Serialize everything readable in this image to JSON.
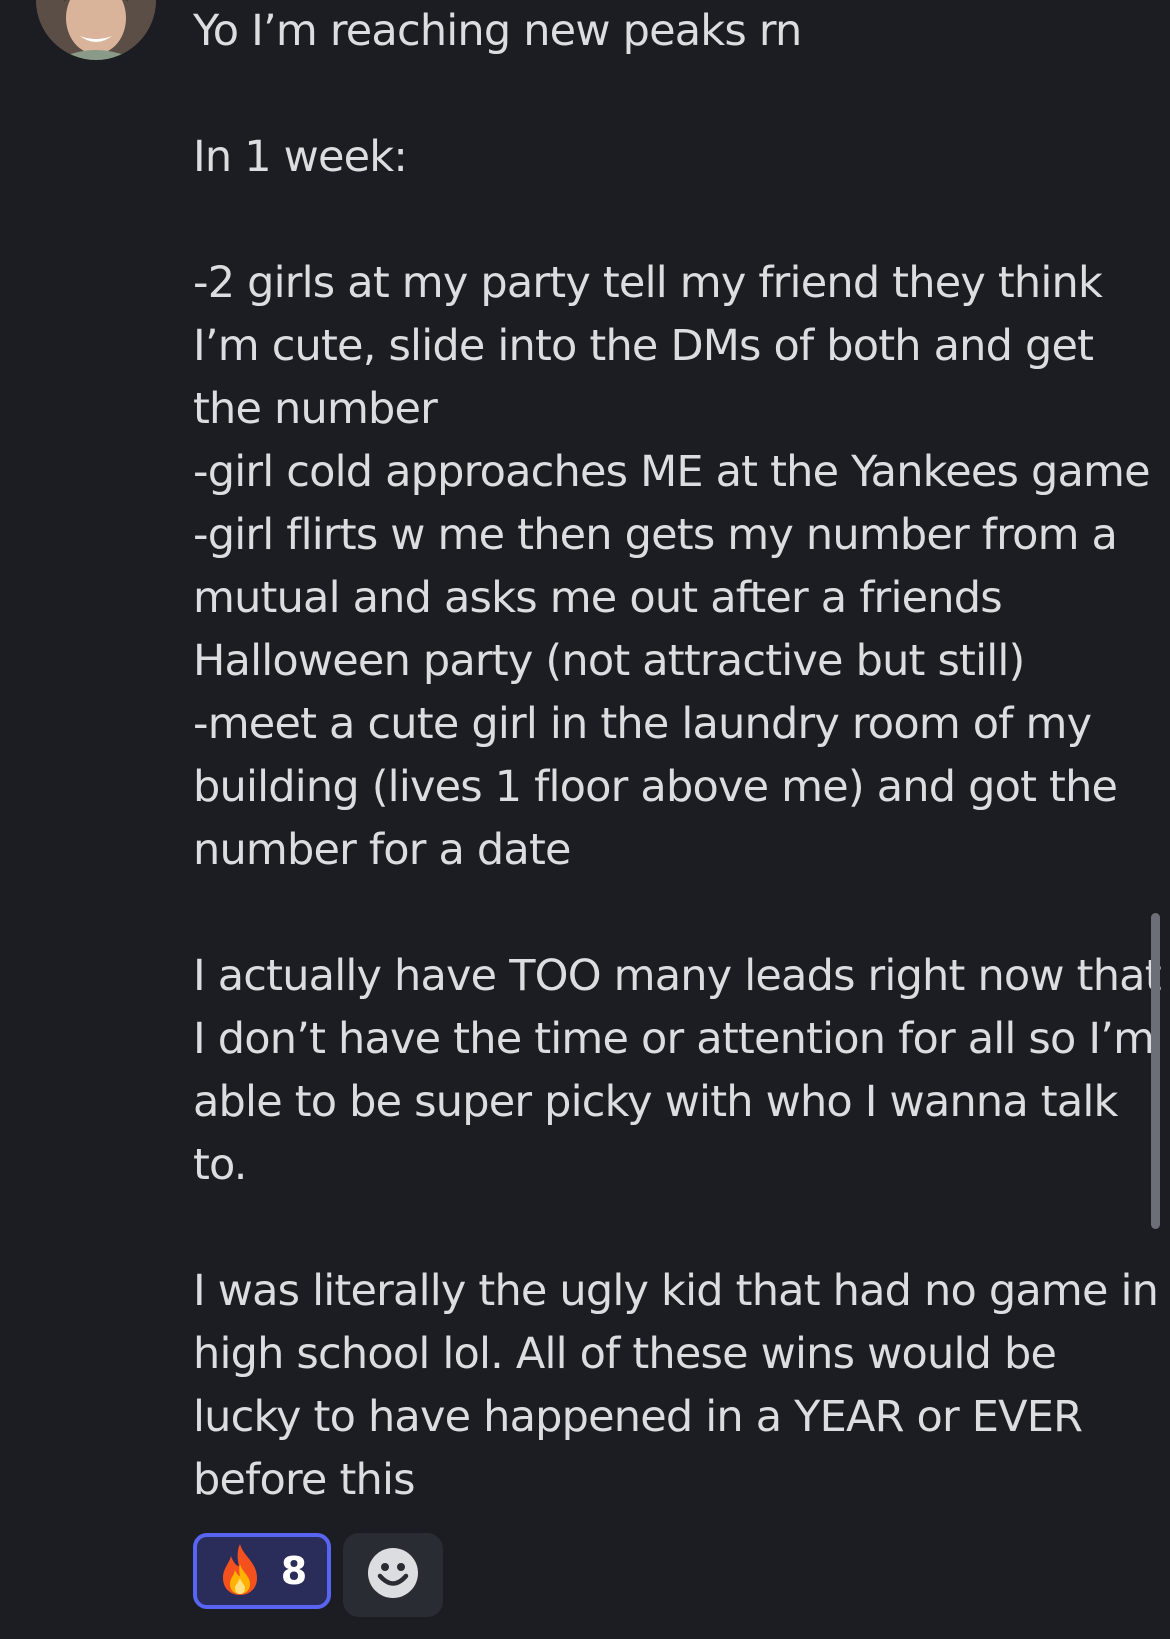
{
  "message": {
    "lines": [
      "Yo I’m reaching new peaks rn",
      "",
      "In 1 week:",
      "",
      "-2 girls at my party tell my friend they think",
      "I’m cute, slide into the DMs of both and get",
      "the number",
      "-girl cold approaches ME at the Yankees game",
      "-girl flirts w me then gets my number from a",
      "mutual and asks me out after a friends",
      "Halloween party (not attractive but still)",
      "-meet a cute girl in the laundry room of my",
      "building (lives 1 floor above me) and got the",
      "number for a date",
      "",
      "I actually have TOO many leads right now that",
      "I don’t have the time or attention for all so I’m",
      "able to be super picky with who I wanna talk",
      "to.",
      "",
      "I was literally the ugly kid that had no game in",
      "high school lol. All of these wins would be",
      "lucky to have happened in a YEAR or EVER",
      "before this"
    ]
  },
  "reactions": {
    "fire": {
      "icon": "fire-icon",
      "count": "8"
    },
    "add": {
      "icon": "smiley-face-icon"
    }
  },
  "colors": {
    "background": "#1c1d22",
    "text": "#dcdde1",
    "reaction_border": "#5865f2",
    "reaction_bg": "#2a2c5a"
  }
}
